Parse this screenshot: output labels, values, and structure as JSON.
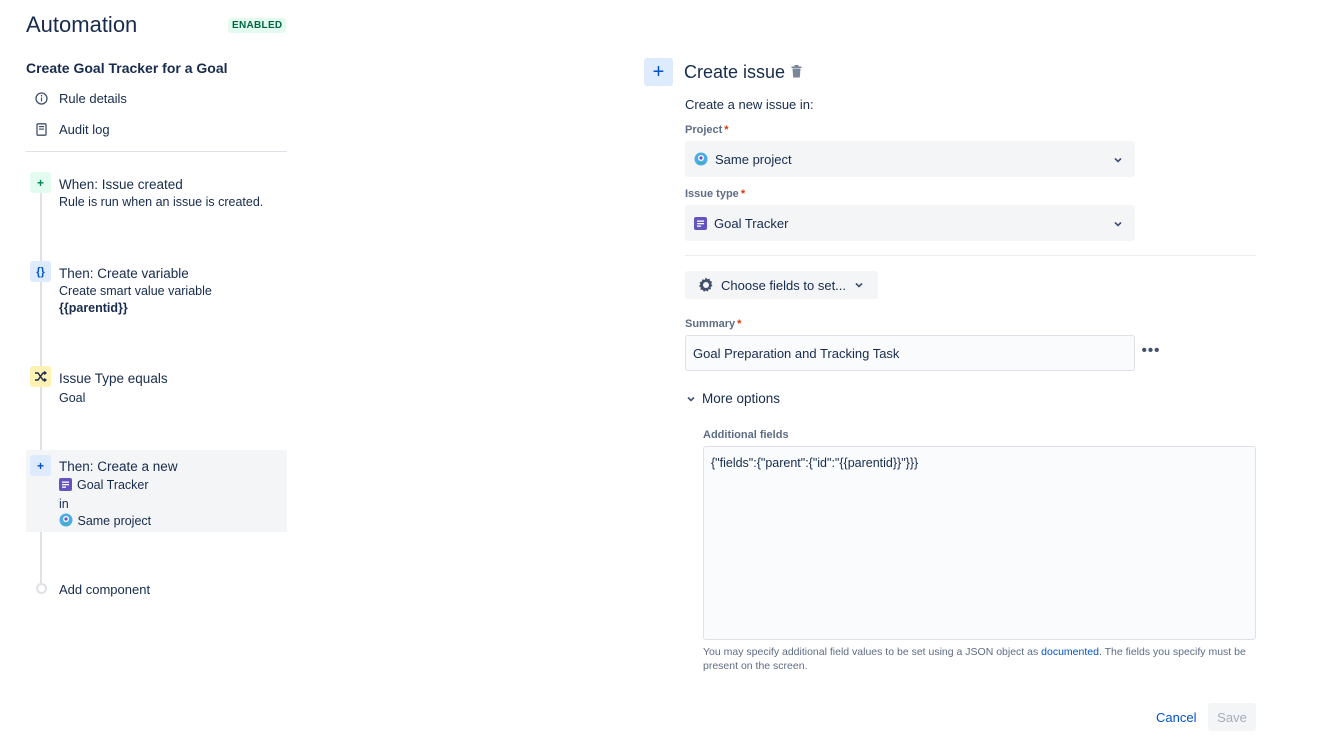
{
  "header": {
    "title": "Automation",
    "status": "ENABLED"
  },
  "rule": {
    "name": "Create Goal Tracker for a Goal"
  },
  "nav": [
    {
      "label": "Rule details",
      "icon": "info-icon"
    },
    {
      "label": "Audit log",
      "icon": "document-icon"
    }
  ],
  "components": [
    {
      "kind": "trigger",
      "icon": "plus-icon",
      "title": "When: Issue created",
      "description": "Rule is run when an issue is created."
    },
    {
      "kind": "action",
      "icon": "braces-icon",
      "title": "Then: Create variable",
      "description": "Create smart value variable",
      "variable": "{{parentid}}"
    },
    {
      "kind": "condition",
      "icon": "shuffle-icon",
      "title": "Issue Type equals",
      "description": "Goal"
    },
    {
      "kind": "action",
      "icon": "plus-icon",
      "title": "Then: Create a new",
      "issue_type": "Goal Tracker",
      "connector": "in",
      "project": "Same project",
      "selected": true
    }
  ],
  "add_component": "Add component",
  "panel": {
    "title": "Create issue",
    "subtitle": "Create a new issue in:",
    "project": {
      "label": "Project",
      "required": "*",
      "value": "Same project"
    },
    "issue_type": {
      "label": "Issue type",
      "required": "*",
      "value": "Goal Tracker"
    },
    "choose_fields": "Choose fields to set...",
    "summary": {
      "label": "Summary",
      "required": "*",
      "value": "Goal Preparation and Tracking Task"
    },
    "more_options": "More options",
    "additional_fields": {
      "label": "Additional fields",
      "value": "{\"fields\":{\"parent\":{\"id\":\"{{parentid}}\"}}}",
      "help_before": "You may specify additional field values to be set using a JSON object as ",
      "help_link": "documented",
      "help_after": ". The fields you specify must be present on the screen."
    },
    "cancel": "Cancel",
    "save": "Save"
  },
  "colors": {
    "accent": "#0052cc",
    "enabled_bg": "#e3fcef",
    "enabled_text": "#006644",
    "trigger_badge": "#e3fcef",
    "action_badge": "#deebff",
    "condition_badge": "#fff0b3",
    "issue_type_purple": "#6554c0"
  }
}
